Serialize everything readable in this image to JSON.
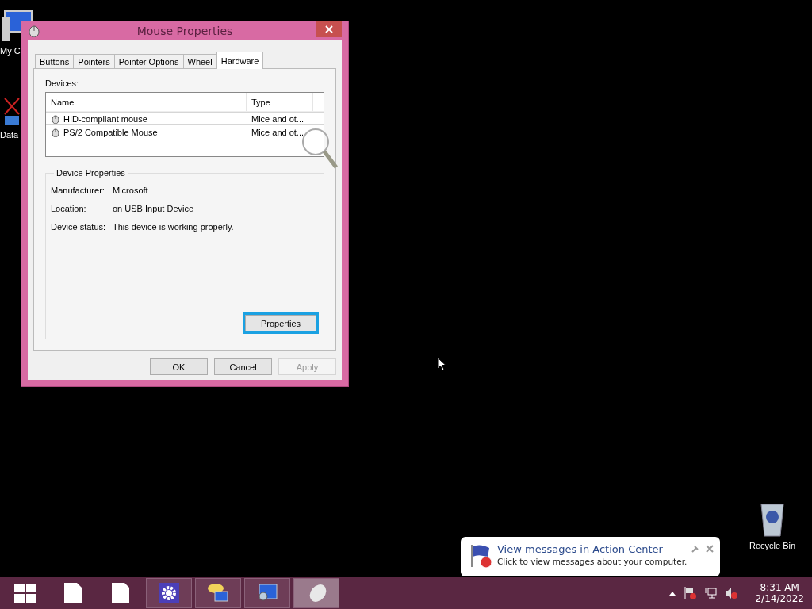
{
  "desktop_icons": [
    {
      "kind": "computer",
      "label": "My C"
    },
    {
      "kind": "data",
      "label": "Data"
    },
    {
      "kind": "bin",
      "label": "Recycle Bin"
    }
  ],
  "window": {
    "title": "Mouse Properties",
    "tabs": [
      {
        "label": "Buttons",
        "selected": false
      },
      {
        "label": "Pointers",
        "selected": false
      },
      {
        "label": "Pointer Options",
        "selected": false
      },
      {
        "label": "Wheel",
        "selected": false
      },
      {
        "label": "Hardware",
        "selected": true
      }
    ],
    "devices_label": "Devices:",
    "columns": [
      "Name",
      "Type"
    ],
    "rows": [
      {
        "name": "HID-compliant mouse",
        "type": "Mice and ot...",
        "selected": true
      },
      {
        "name": "PS/2 Compatible Mouse",
        "type": "Mice and ot...",
        "selected": false
      }
    ],
    "group_title": "Device Properties",
    "fields": [
      {
        "label": "Manufacturer:",
        "value": "Microsoft"
      },
      {
        "label": "Location:",
        "value": "on USB Input Device"
      },
      {
        "label": "Device status:",
        "value": "This device is working properly."
      }
    ],
    "properties_button": {
      "label": "Properties",
      "focused": true
    },
    "buttons": [
      {
        "label": "OK",
        "disabled": false
      },
      {
        "label": "Cancel",
        "disabled": false
      },
      {
        "label": "Apply",
        "disabled": true
      }
    ]
  },
  "notification": {
    "title": "View messages in Action Center",
    "text": "Click to view messages about your computer."
  },
  "taskbar": {
    "items": [
      {
        "kind": "start",
        "selected": false
      },
      {
        "kind": "file",
        "selected": false
      },
      {
        "kind": "file",
        "selected": false
      },
      {
        "kind": "settings",
        "selected": false
      },
      {
        "kind": "chat",
        "selected": false
      },
      {
        "kind": "monitor",
        "selected": false
      },
      {
        "kind": "mouse",
        "selected": true
      }
    ],
    "time": "8:31 AM",
    "date": "2/14/2022"
  }
}
